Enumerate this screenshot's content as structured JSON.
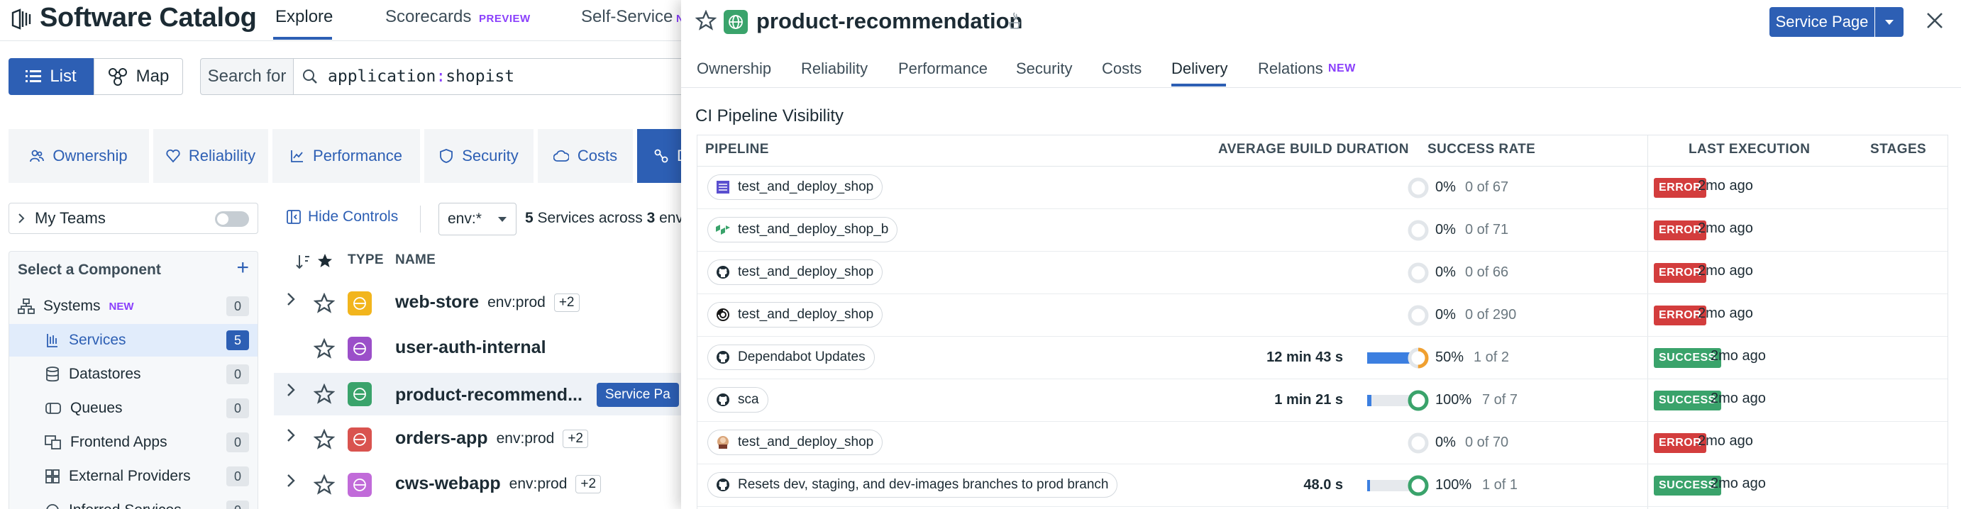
{
  "app": {
    "title": "Software Catalog",
    "nav": [
      {
        "label": "Explore",
        "active": true
      },
      {
        "label": "Scorecards",
        "badge": "PREVIEW"
      },
      {
        "label": "Self-Service",
        "badge": "N"
      }
    ]
  },
  "view_toggle": {
    "list_label": "List",
    "map_label": "Map"
  },
  "search": {
    "label": "Search for",
    "query_key": "application",
    "query_sep": ":",
    "query_value": "shopist"
  },
  "perf_tabs": [
    {
      "label": "Ownership"
    },
    {
      "label": "Reliability"
    },
    {
      "label": "Performance"
    },
    {
      "label": "Security"
    },
    {
      "label": "Costs"
    },
    {
      "label": "D",
      "active": true
    }
  ],
  "my_teams": {
    "label": "My Teams"
  },
  "components": {
    "title": "Select a Component",
    "items": [
      {
        "label": "Systems",
        "badge": "NEW",
        "count": "0",
        "icon": "systems-icon"
      },
      {
        "label": "Services",
        "count": "5",
        "icon": "services-icon",
        "active": true
      },
      {
        "label": "Datastores",
        "count": "0",
        "icon": "datastore-icon"
      },
      {
        "label": "Queues",
        "count": "0",
        "icon": "queue-icon"
      },
      {
        "label": "Frontend Apps",
        "count": "0",
        "icon": "frontend-icon"
      },
      {
        "label": "External Providers",
        "count": "0",
        "icon": "external-icon"
      },
      {
        "label": "Inferred Services",
        "count": "0",
        "icon": "inferred-icon"
      }
    ]
  },
  "controls": {
    "hide_label": "Hide Controls",
    "env_value": "env:*",
    "services_prefix": "5",
    "services_text": " Services across ",
    "envs_num": "3",
    "envs_text": " envs"
  },
  "services_table": {
    "col_type": "TYPE",
    "col_name": "NAME",
    "rows": [
      {
        "name": "web-store",
        "type_color": "#f2b51d",
        "tag": "env:prod",
        "more": "+2",
        "expandable": true
      },
      {
        "name": "user-auth-internal",
        "type_color": "#9b4fc9",
        "tag": "",
        "more": "",
        "expandable": false
      },
      {
        "name": "product-recommend...",
        "type_color": "#3aa36b",
        "tag": "",
        "more": "",
        "expandable": true,
        "highlight": true,
        "action": "Service Pa"
      },
      {
        "name": "orders-app",
        "type_color": "#d9534f",
        "tag": "env:prod",
        "more": "+2",
        "expandable": true
      },
      {
        "name": "cws-webapp",
        "type_color": "#c16bd9",
        "tag": "env:prod",
        "more": "+2",
        "expandable": true
      }
    ]
  },
  "panel": {
    "title": "product-recommendation",
    "service_page_label": "Service Page",
    "tabs": [
      {
        "label": "Ownership"
      },
      {
        "label": "Reliability"
      },
      {
        "label": "Performance"
      },
      {
        "label": "Security"
      },
      {
        "label": "Costs"
      },
      {
        "label": "Delivery",
        "active": true
      },
      {
        "label": "Relations",
        "badge": "NEW"
      }
    ],
    "section_title": "CI Pipeline Visibility",
    "columns": {
      "pipeline": "PIPELINE",
      "avg_duration": "AVERAGE BUILD DURATION",
      "success_rate": "SUCCESS RATE",
      "last_execution": "LAST EXECUTION",
      "stages": "STAGES"
    },
    "pipelines": [
      {
        "name": "test_and_deploy_shop",
        "provider": "gitlab-icon",
        "duration": "",
        "duration_fill": 0,
        "rate": "0%",
        "rate_value": 0,
        "count": "0 of 67",
        "status": "ERROR",
        "last": "2mo ago"
      },
      {
        "name": "test_and_deploy_shop_b",
        "provider": "buildkite-icon",
        "duration": "",
        "duration_fill": 0,
        "rate": "0%",
        "rate_value": 0,
        "count": "0 of 71",
        "status": "ERROR",
        "last": "2mo ago"
      },
      {
        "name": "test_and_deploy_shop",
        "provider": "github-icon",
        "duration": "",
        "duration_fill": 0,
        "rate": "0%",
        "rate_value": 0,
        "count": "0 of 66",
        "status": "ERROR",
        "last": "2mo ago"
      },
      {
        "name": "test_and_deploy_shop",
        "provider": "circleci-icon",
        "duration": "",
        "duration_fill": 0,
        "rate": "0%",
        "rate_value": 0,
        "count": "0 of 290",
        "status": "ERROR",
        "last": "2mo ago"
      },
      {
        "name": "Dependabot Updates",
        "provider": "github-icon",
        "duration": "12 min 43 s",
        "duration_fill": 1.0,
        "rate": "50%",
        "rate_value": 50,
        "count": "1 of 2",
        "status": "SUCCESS",
        "last": "2mo ago"
      },
      {
        "name": "sca",
        "provider": "github-icon",
        "duration": "1 min 21 s",
        "duration_fill": 0.1,
        "rate": "100%",
        "rate_value": 100,
        "count": "7 of 7",
        "status": "SUCCESS",
        "last": "2mo ago"
      },
      {
        "name": "test_and_deploy_shop",
        "provider": "jenkins-icon",
        "duration": "",
        "duration_fill": 0,
        "rate": "0%",
        "rate_value": 0,
        "count": "0 of 70",
        "status": "ERROR",
        "last": "2mo ago"
      },
      {
        "name": "Resets dev, staging, and dev-images branches to prod branch",
        "provider": "github-icon",
        "duration": "48.0 s",
        "duration_fill": 0.06,
        "rate": "100%",
        "rate_value": 100,
        "count": "1 of 1",
        "status": "SUCCESS",
        "last": "2mo ago"
      }
    ]
  },
  "colors": {
    "accent": "#2d5fb4",
    "success": "#3aa36b",
    "error": "#d33d3d",
    "warning": "#f0a030",
    "new_badge": "#8a3ffc"
  }
}
